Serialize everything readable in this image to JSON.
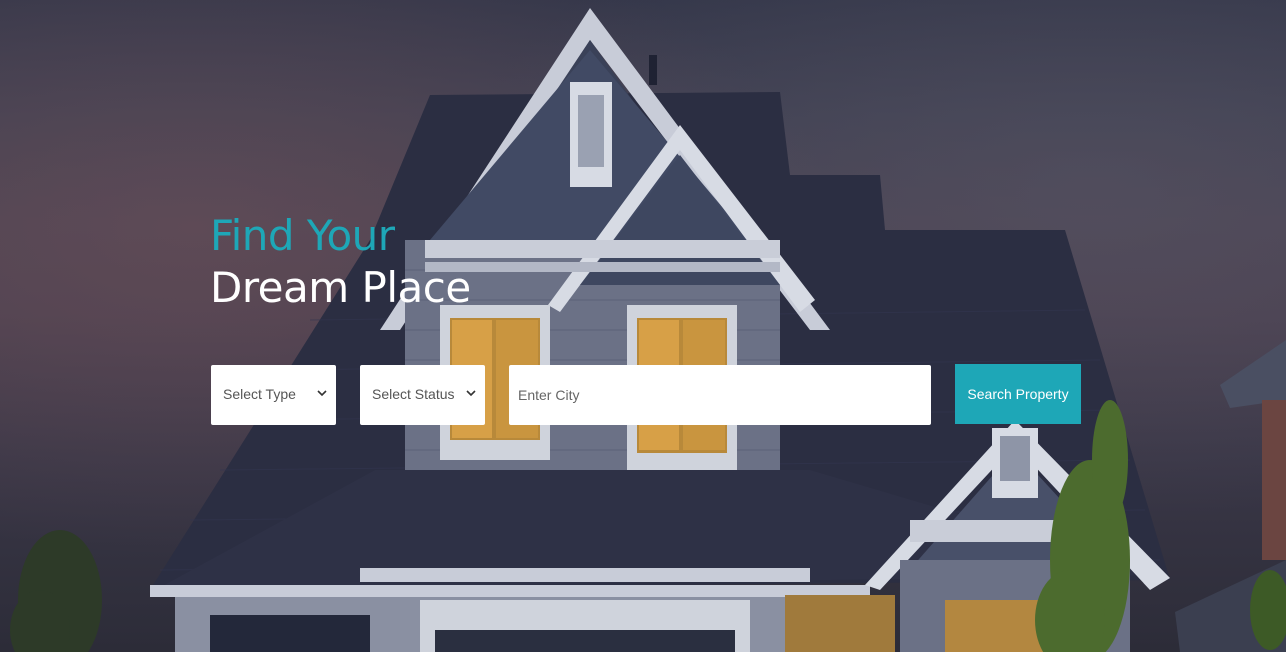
{
  "hero": {
    "title_line1": "Find Your",
    "title_line2": "Dream Place",
    "accent_color": "#1ea7b7",
    "background": "house-at-dusk-photo"
  },
  "search": {
    "type_select": {
      "selected": "Select Type",
      "icon": "chevron-down-icon"
    },
    "status_select": {
      "selected": "Select Status",
      "icon": "chevron-down-icon"
    },
    "city_placeholder": "Enter City",
    "city_value": "",
    "button_label": "Search Property"
  }
}
